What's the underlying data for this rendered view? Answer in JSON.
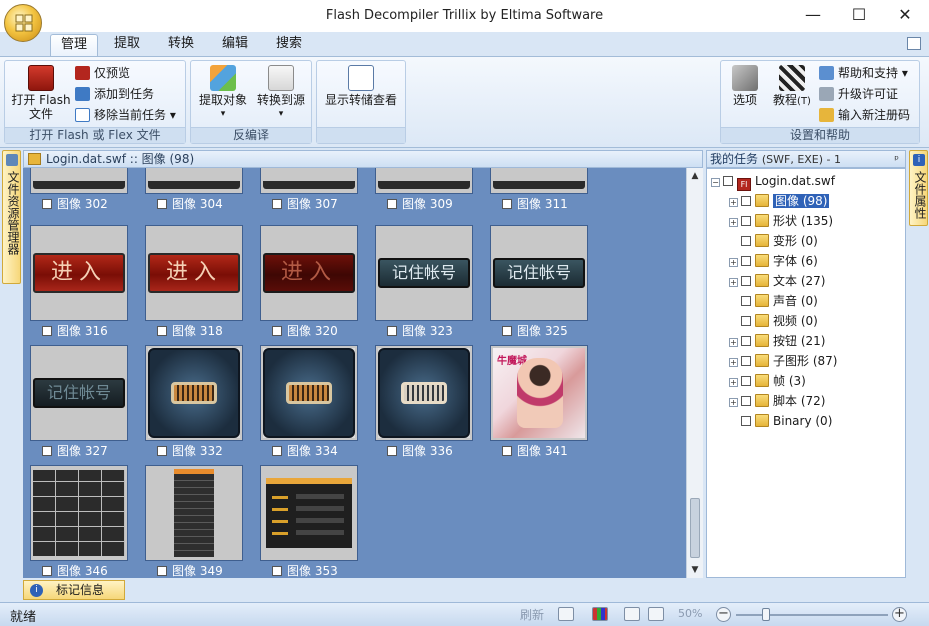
{
  "app": {
    "title": "Flash Decompiler Trillix by Eltima Software",
    "window_controls": {
      "minimize": "—",
      "maximize": "☐",
      "close": "✕"
    }
  },
  "ribbon": {
    "tabs": [
      {
        "label": "管理",
        "active": true
      },
      {
        "label": "提取",
        "active": false
      },
      {
        "label": "转换",
        "active": false
      },
      {
        "label": "编辑",
        "active": false
      },
      {
        "label": "搜索",
        "active": false
      }
    ],
    "groups": {
      "open": {
        "label": "打开 Flash 或 Flex 文件",
        "open_button": "打开 Flash\n文件",
        "preview": "仅预览",
        "add_task": "添加到任务",
        "remove_task": "移除当前任务"
      },
      "decompile": {
        "label": "反编译",
        "extract": "提取对象",
        "convert": "转换到源"
      },
      "dump": {
        "view": "显示转储查看"
      },
      "help": {
        "label": "设置和帮助",
        "options": "选项",
        "tutorial": "教程",
        "tutorial_key": "(T)",
        "support": "帮助和支持",
        "upgrade": "升级许可证",
        "register": "输入新注册码"
      }
    }
  },
  "left_panel": {
    "label": "文件资源管理器"
  },
  "right_side_panel": {
    "label": "文件属性"
  },
  "center": {
    "header": "Login.dat.swf :: 图像 (98)",
    "items": [
      {
        "label": "图像 302",
        "kind": "cut"
      },
      {
        "label": "图像 304",
        "kind": "cut"
      },
      {
        "label": "图像 307",
        "kind": "cut"
      },
      {
        "label": "图像 309",
        "kind": "cut"
      },
      {
        "label": "图像 311",
        "kind": "cut"
      },
      {
        "label": "图像 316",
        "kind": "red",
        "text": "进入"
      },
      {
        "label": "图像 318",
        "kind": "red",
        "text": "进入"
      },
      {
        "label": "图像 320",
        "kind": "darkred",
        "text": "进入"
      },
      {
        "label": "图像 323",
        "kind": "teal",
        "text": "记住帐号"
      },
      {
        "label": "图像 325",
        "kind": "teal",
        "text": "记住帐号"
      },
      {
        "label": "图像 327",
        "kind": "tealdim",
        "text": "记住帐号"
      },
      {
        "label": "图像 332",
        "kind": "kb"
      },
      {
        "label": "图像 334",
        "kind": "kb"
      },
      {
        "label": "图像 336",
        "kind": "kbalt"
      },
      {
        "label": "图像 341",
        "kind": "photo",
        "text": "牛魔城"
      },
      {
        "label": "图像 346",
        "kind": "grid"
      },
      {
        "label": "图像 349",
        "kind": "panel"
      },
      {
        "label": "图像 353",
        "kind": "menu"
      }
    ]
  },
  "tasks": {
    "header": "我的任务",
    "header_sub": "(SWF, EXE) - 1",
    "pin": "ᵖ",
    "root": "Login.dat.swf",
    "nodes": [
      {
        "label": "图像 (98)",
        "expandable": true,
        "selected": true
      },
      {
        "label": "形状 (135)",
        "expandable": true,
        "selected": false
      },
      {
        "label": "变形 (0)",
        "expandable": false,
        "selected": false
      },
      {
        "label": "字体 (6)",
        "expandable": true,
        "selected": false
      },
      {
        "label": "文本 (27)",
        "expandable": true,
        "selected": false
      },
      {
        "label": "声音 (0)",
        "expandable": false,
        "selected": false
      },
      {
        "label": "视频 (0)",
        "expandable": false,
        "selected": false
      },
      {
        "label": "按钮 (21)",
        "expandable": true,
        "selected": false
      },
      {
        "label": "子图形 (87)",
        "expandable": true,
        "selected": false
      },
      {
        "label": "帧 (3)",
        "expandable": true,
        "selected": false
      },
      {
        "label": "脚本 (72)",
        "expandable": true,
        "selected": false
      },
      {
        "label": "Binary (0)",
        "expandable": false,
        "selected": false
      }
    ]
  },
  "info_tab": {
    "label": "标记信息"
  },
  "status": {
    "text": "就绪",
    "refresh": "刷新",
    "zoom": "50%",
    "zoom_fraction": 0.2
  }
}
